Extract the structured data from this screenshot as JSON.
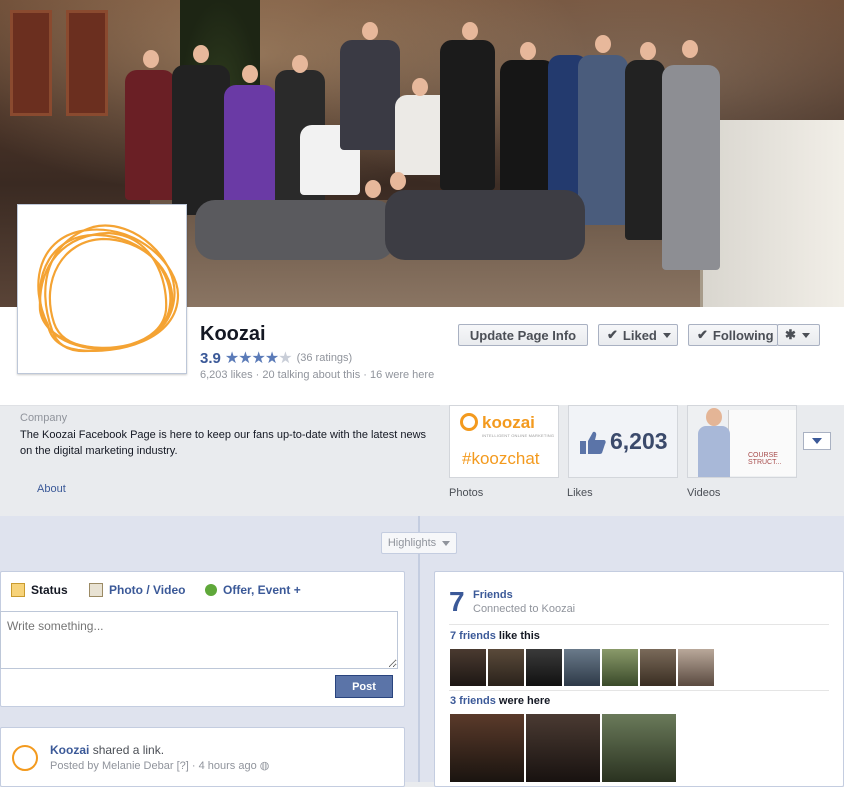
{
  "page": {
    "name": "Koozai",
    "rating_value": "3.9",
    "rating_stars": 4,
    "rating_count": "(36 ratings)",
    "stats": "6,203 likes · 20 talking about this · 16 were here"
  },
  "actions": {
    "update_info": "Update Page Info",
    "liked": "Liked",
    "following": "Following"
  },
  "about": {
    "category": "Company",
    "description": "The Koozai Facebook Page is here to keep our fans up-to-date with the latest news on the digital marketing industry.",
    "link": "About"
  },
  "apps": {
    "photos": {
      "label": "Photos",
      "brand": "koozai",
      "tagline": "INTELLIGENT ONLINE MARKETING",
      "hashtag": "#koozchat"
    },
    "likes": {
      "label": "Likes",
      "count": "6,203"
    },
    "videos": {
      "label": "Videos",
      "whiteboard_text": "COURSE STRUCT..."
    }
  },
  "timeline": {
    "highlights": "Highlights"
  },
  "composer": {
    "tabs": [
      "Status",
      "Photo / Video",
      "Offer, Event +"
    ],
    "placeholder": "Write something...",
    "post": "Post"
  },
  "post": {
    "author": "Koozai",
    "action": "shared a link.",
    "posted_by_prefix": "Posted by ",
    "posted_by": "Melanie Debar",
    "meta": "[?] · 4 hours ago"
  },
  "friends": {
    "count": "7",
    "title": "Friends",
    "subtitle": "Connected to Koozai",
    "like_link": "7 friends",
    "like_suffix": " like this",
    "here_link": "3 friends",
    "here_suffix": " were here"
  },
  "colors": {
    "brand_orange": "#f39a1e",
    "facebook_blue": "#3b5998",
    "post_button": "#5b74a8"
  }
}
